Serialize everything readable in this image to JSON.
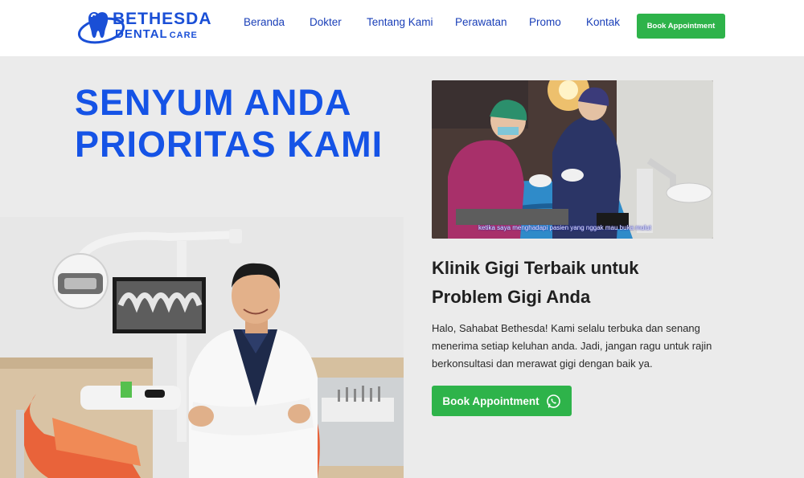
{
  "brand": {
    "name_line1": "BETHESDA",
    "name_line2": "DENTAL",
    "name_line2_suffix": "CARE",
    "color": "#1a4fd6"
  },
  "nav": {
    "items": [
      {
        "label": "Beranda"
      },
      {
        "label": "Dokter"
      },
      {
        "label": "Tentang Kami"
      },
      {
        "label": "Perawatan"
      },
      {
        "label": "Promo"
      },
      {
        "label": "Kontak"
      }
    ],
    "cta_label": "Book Appointment"
  },
  "hero": {
    "headline_line1": "SENYUM ANDA",
    "headline_line2": "PRIORITAS KAMI",
    "video_caption": "ketika saya menghadapi pasien yang nggak mau buka mulut",
    "subheading_line1": "Klinik Gigi Terbaik untuk",
    "subheading_line2": "Problem Gigi Anda",
    "paragraph": "Halo, Sahabat Bethesda! Kami selalu terbuka dan senang menerima setiap keluhan anda. Jadi, jangan ragu untuk rajin berkonsultasi dan merawat gigi dengan baik ya.",
    "cta_label": "Book Appointment",
    "cta_icon": "whatsapp-icon"
  },
  "colors": {
    "accent_blue": "#1553e6",
    "cta_green": "#2eb34a",
    "background": "#ebebeb"
  }
}
